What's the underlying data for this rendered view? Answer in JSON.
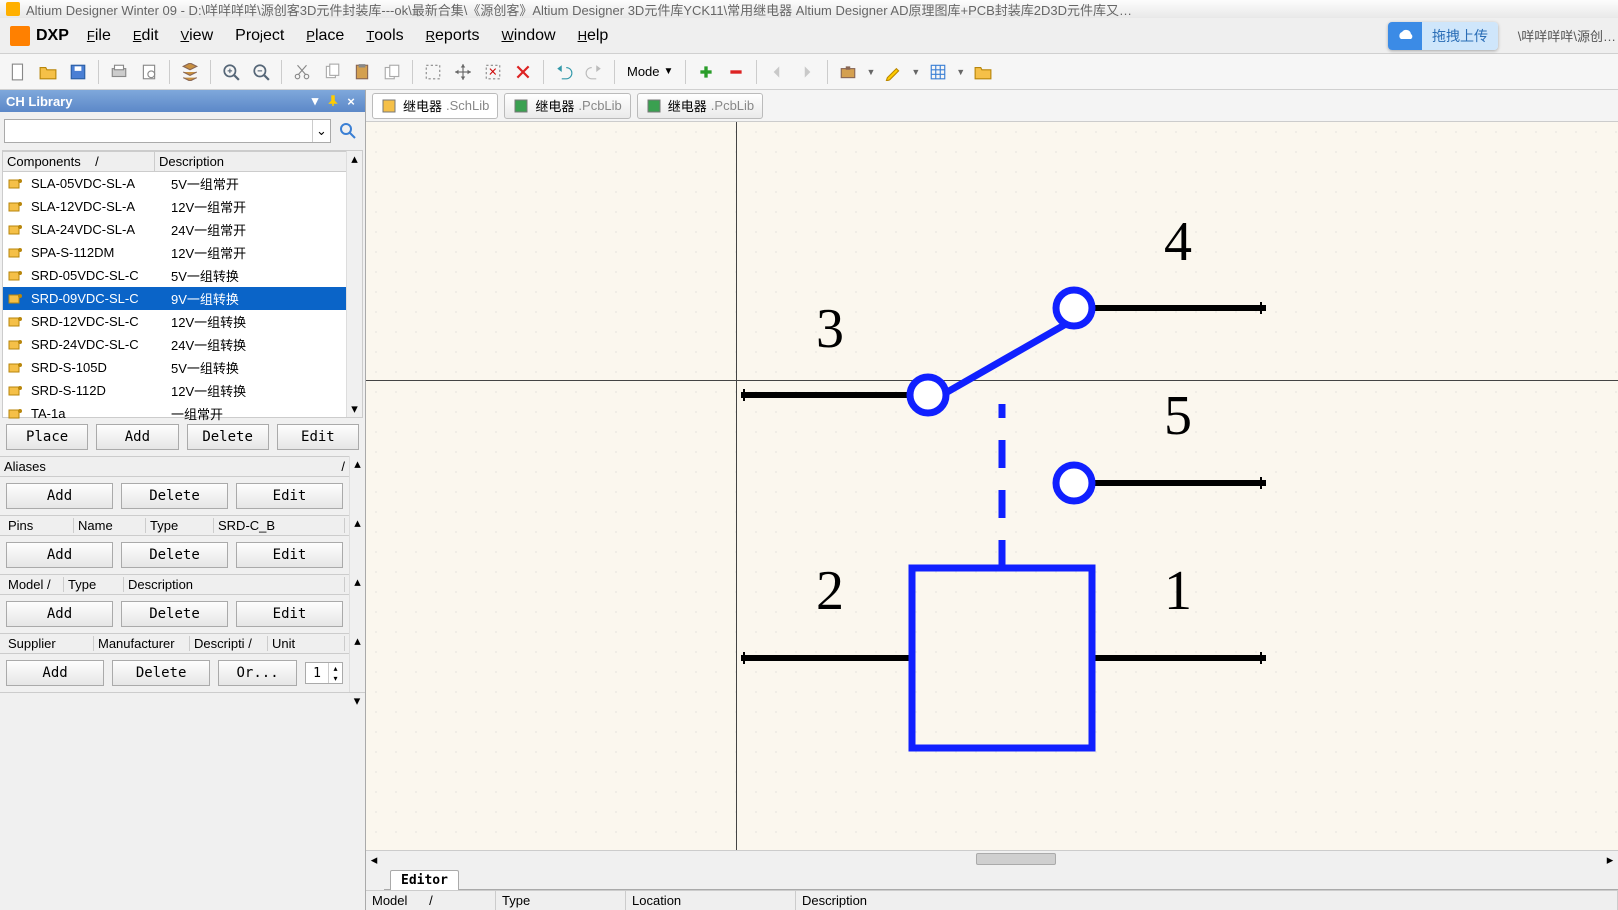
{
  "title_prefix": "Altium Designer Winter 09 - D:\\咩咩咩咩\\源创客3D元件封装库---ok\\最新合集\\《源创客》Altium Designer 3D元件库YCK11\\常用继电器 Altium Designer AD原理图库+PCB封装库2D3D元件库又…",
  "dxp_label": "DXP",
  "menu": [
    "File",
    "Edit",
    "View",
    "Project",
    "Place",
    "Tools",
    "Reports",
    "Window",
    "Help"
  ],
  "mode_label": "Mode",
  "panel_title": "CH Library",
  "cloud_text": "拖拽上传",
  "path_tail": "\\咩咩咩咩\\源创…",
  "headers": {
    "components": "Components",
    "description": "Description",
    "sort": "/"
  },
  "components": [
    {
      "name": "SLA-05VDC-SL-A",
      "desc": "5V一组常开"
    },
    {
      "name": "SLA-12VDC-SL-A",
      "desc": "12V一组常开"
    },
    {
      "name": "SLA-24VDC-SL-A",
      "desc": "24V一组常开"
    },
    {
      "name": "SPA-S-112DM",
      "desc": "12V一组常开"
    },
    {
      "name": "SRD-05VDC-SL-C",
      "desc": "5V一组转换"
    },
    {
      "name": "SRD-09VDC-SL-C",
      "desc": "9V一组转换"
    },
    {
      "name": "SRD-12VDC-SL-C",
      "desc": "12V一组转换"
    },
    {
      "name": "SRD-24VDC-SL-C",
      "desc": "24V一组转换"
    },
    {
      "name": "SRD-S-105D",
      "desc": "5V一组转换"
    },
    {
      "name": "SRD-S-112D",
      "desc": "12V一组转换"
    },
    {
      "name": "TA-1a",
      "desc": "一组常开"
    }
  ],
  "selected_index": 5,
  "btns": {
    "place": "Place",
    "add": "Add",
    "delete": "Delete",
    "edit": "Edit",
    "or": "Or..."
  },
  "aliases_hdr": "Aliases",
  "pins_hdr": {
    "pins": "Pins",
    "name": "Name",
    "type": "Type",
    "value": "SRD-C_B"
  },
  "model_hdr": {
    "model": "Model",
    "type": "Type",
    "description": "Description"
  },
  "supplier_hdr": {
    "supplier": "Supplier",
    "manu": "Manufacturer",
    "desc": "Descripti",
    "unit": "Unit"
  },
  "or_value": "1",
  "tabs": [
    {
      "name": "继电器",
      "ext": ".SchLib",
      "active": true,
      "icon": "sch"
    },
    {
      "name": "继电器",
      "ext": ".PcbLib",
      "active": false,
      "icon": "pcb"
    },
    {
      "name": "继电器",
      "ext": ".PcbLib",
      "active": false,
      "icon": "pcb"
    }
  ],
  "editor_tab": "Editor",
  "model_cols": {
    "model": "Model",
    "type": "Type",
    "location": "Location",
    "description": "Description"
  },
  "pin_numbers": {
    "p1": "1",
    "p2": "2",
    "p3": "3",
    "p4": "4",
    "p5": "5"
  }
}
